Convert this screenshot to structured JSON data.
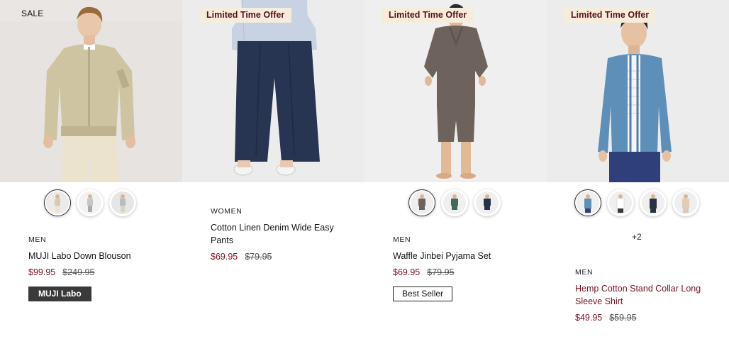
{
  "products": [
    {
      "badge": "SALE",
      "category": "MEN",
      "name": "MUJI Labo Down Blouson",
      "price": "$99.95",
      "was_price": "$249.95",
      "tag": "MUJI Labo",
      "swatch_colors": [
        "#d5cbb0",
        "#c4c6c8",
        "#b9bcbf"
      ]
    },
    {
      "badge": "Limited Time Offer",
      "category": "WOMEN",
      "name": "Cotton Linen Denim Wide Easy Pants",
      "price": "$69.95",
      "was_price": "$79.95"
    },
    {
      "badge": "Limited Time Offer",
      "category": "MEN",
      "name": "Waffle Jinbei Pyjama Set",
      "price": "$69.95",
      "was_price": "$79.95",
      "tag": "Best Seller",
      "swatch_colors": [
        "#6e635c",
        "#3f6b58",
        "#26334a"
      ]
    },
    {
      "badge": "Limited Time Offer",
      "category": "MEN",
      "name": "Hemp Cotton Stand Collar Long Sleeve Shirt",
      "price": "$49.95",
      "was_price": "$59.95",
      "more_colors": "+2",
      "swatch_colors": [
        "#5e8fb8",
        "#f2f2f0",
        "#2a3346",
        "#e0cdb8"
      ]
    }
  ],
  "colors": {
    "sale_red": "#7a1020",
    "offer_badge_bg": "#f5ecdc",
    "tag_dark_bg": "#3a3a3a"
  }
}
